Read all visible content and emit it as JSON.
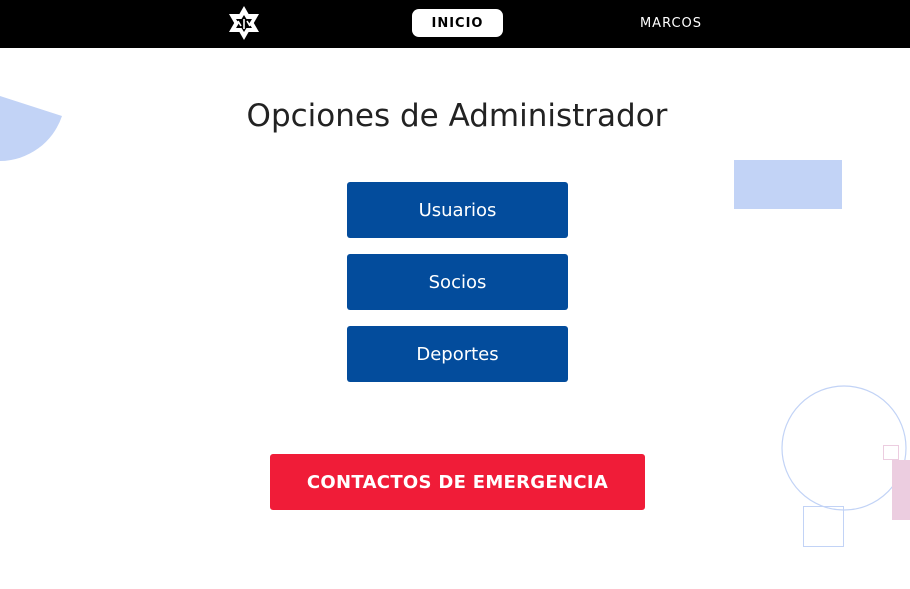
{
  "nav": {
    "logo_icon": "star-of-david-logo-icon",
    "items": [
      {
        "label": "INICIO",
        "active": true
      },
      {
        "label": "MARCOS",
        "active": false
      }
    ]
  },
  "main": {
    "title": "Opciones de Administrador",
    "buttons": [
      {
        "label": "Usuarios"
      },
      {
        "label": "Socios"
      },
      {
        "label": "Deportes"
      }
    ],
    "emergency_label": "CONTACTOS DE EMERGENCIA"
  },
  "colors": {
    "topbar": "#000000",
    "primary_button": "#034c9c",
    "emergency_button": "#f01c38",
    "deco_blue": "#c2d3f6",
    "deco_pink": "#eccde0"
  }
}
